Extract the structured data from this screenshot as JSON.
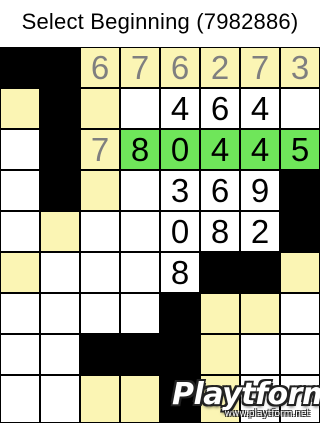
{
  "title": "Select Beginning (7982886)",
  "colors": {
    "white_cell": "#ffffff",
    "clue_cell": "#fbf5b4",
    "selected_cell": "#6fe65a",
    "black_cell": "#000000",
    "clue_digit": "#7f7f7f",
    "entry_digit": "#000000"
  },
  "grid": {
    "rows": 9,
    "cols": 8,
    "legend": "w = white, y = pale yellow, g = green (selected run), b = black",
    "cells": [
      [
        {
          "c": "b",
          "v": ""
        },
        {
          "c": "b",
          "v": ""
        },
        {
          "c": "y",
          "v": "6"
        },
        {
          "c": "y",
          "v": "7"
        },
        {
          "c": "y",
          "v": "6"
        },
        {
          "c": "y",
          "v": "2"
        },
        {
          "c": "y",
          "v": "7"
        },
        {
          "c": "y",
          "v": "3"
        }
      ],
      [
        {
          "c": "y",
          "v": ""
        },
        {
          "c": "b",
          "v": ""
        },
        {
          "c": "y",
          "v": ""
        },
        {
          "c": "w",
          "v": ""
        },
        {
          "c": "w",
          "v": "4"
        },
        {
          "c": "w",
          "v": "6"
        },
        {
          "c": "w",
          "v": "4"
        },
        {
          "c": "w",
          "v": ""
        }
      ],
      [
        {
          "c": "w",
          "v": ""
        },
        {
          "c": "b",
          "v": ""
        },
        {
          "c": "y",
          "v": "7"
        },
        {
          "c": "g",
          "v": "8"
        },
        {
          "c": "g",
          "v": "0"
        },
        {
          "c": "g",
          "v": "4"
        },
        {
          "c": "g",
          "v": "4"
        },
        {
          "c": "g",
          "v": "5"
        }
      ],
      [
        {
          "c": "w",
          "v": ""
        },
        {
          "c": "b",
          "v": ""
        },
        {
          "c": "y",
          "v": ""
        },
        {
          "c": "w",
          "v": ""
        },
        {
          "c": "w",
          "v": "3"
        },
        {
          "c": "w",
          "v": "6"
        },
        {
          "c": "w",
          "v": "9"
        },
        {
          "c": "b",
          "v": ""
        }
      ],
      [
        {
          "c": "w",
          "v": ""
        },
        {
          "c": "y",
          "v": ""
        },
        {
          "c": "w",
          "v": ""
        },
        {
          "c": "w",
          "v": ""
        },
        {
          "c": "w",
          "v": "0"
        },
        {
          "c": "w",
          "v": "8"
        },
        {
          "c": "w",
          "v": "2"
        },
        {
          "c": "b",
          "v": ""
        }
      ],
      [
        {
          "c": "y",
          "v": ""
        },
        {
          "c": "w",
          "v": ""
        },
        {
          "c": "w",
          "v": ""
        },
        {
          "c": "w",
          "v": ""
        },
        {
          "c": "w",
          "v": "8"
        },
        {
          "c": "b",
          "v": ""
        },
        {
          "c": "b",
          "v": ""
        },
        {
          "c": "y",
          "v": ""
        }
      ],
      [
        {
          "c": "w",
          "v": ""
        },
        {
          "c": "w",
          "v": ""
        },
        {
          "c": "w",
          "v": ""
        },
        {
          "c": "w",
          "v": ""
        },
        {
          "c": "b",
          "v": ""
        },
        {
          "c": "y",
          "v": ""
        },
        {
          "c": "y",
          "v": ""
        },
        {
          "c": "w",
          "v": ""
        }
      ],
      [
        {
          "c": "w",
          "v": ""
        },
        {
          "c": "w",
          "v": ""
        },
        {
          "c": "b",
          "v": ""
        },
        {
          "c": "b",
          "v": ""
        },
        {
          "c": "b",
          "v": ""
        },
        {
          "c": "y",
          "v": ""
        },
        {
          "c": "w",
          "v": ""
        },
        {
          "c": "w",
          "v": ""
        }
      ],
      [
        {
          "c": "w",
          "v": ""
        },
        {
          "c": "w",
          "v": ""
        },
        {
          "c": "y",
          "v": ""
        },
        {
          "c": "y",
          "v": ""
        },
        {
          "c": "b",
          "v": ""
        },
        {
          "c": "y",
          "v": ""
        },
        {
          "c": "w",
          "v": ""
        },
        {
          "c": "w",
          "v": ""
        }
      ]
    ]
  },
  "watermark": {
    "brand": "Playtform",
    "url": "www.playtform.net"
  }
}
